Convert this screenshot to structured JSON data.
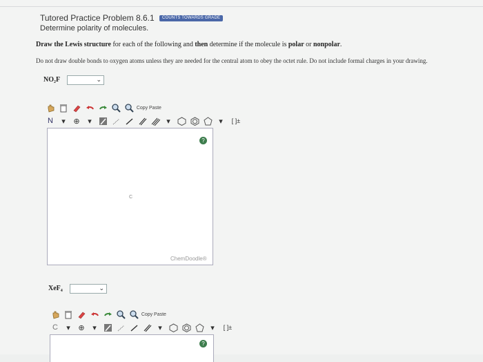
{
  "header": {
    "title": "Tutored Practice Problem 8.6.1",
    "badge": "COUNTS TOWARDS GRADE",
    "subtitle": "Determine polarity of molecules."
  },
  "instructions": {
    "lead": "Draw the Lewis structure",
    "middle": "for each of the following and",
    "then": "then",
    "middle2": "determine if the molecule is",
    "polar": "polar",
    "or": "or",
    "nonpolar": "nonpolar",
    "end": "."
  },
  "note": "Do not draw double bonds to oxygen atoms unless they are needed for the central atom to obey the octet rule. Do not include formal charges in your drawing.",
  "questions": [
    {
      "molecule": "NO₂F",
      "selected": ""
    },
    {
      "molecule": "XeF₄",
      "selected": ""
    }
  ],
  "editor": {
    "copy_label": "C",
    "copy_sub": "opy",
    "paste_label": "P",
    "paste_sub": "aste",
    "element_button": "N",
    "canvas_mark": "C",
    "brand": "ChemDoodle®",
    "help_symbol": "?",
    "bracket_tool": "[ ]±"
  }
}
